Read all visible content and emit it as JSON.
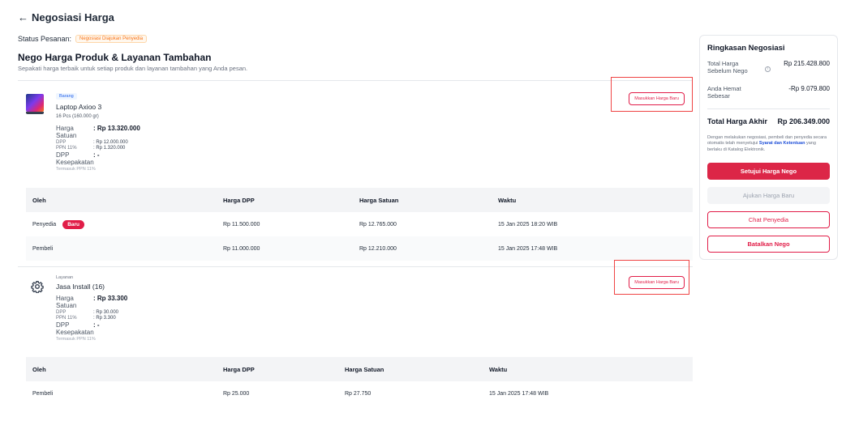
{
  "page": {
    "back_label": "Negosiasi Harga"
  },
  "order": {
    "status_label": "Status Pesanan:",
    "status_value": "Negosiasi Diajukan Penyedia"
  },
  "section": {
    "title": "Nego Harga Produk & Layanan Tambahan",
    "subtitle": "Sepakati harga terbaik untuk setiap produk dan layanan tambahan yang Anda pesan."
  },
  "items": [
    {
      "type_label": "Barang",
      "name": "Laptop Axioo 3",
      "qty": "16 Pcs (160.000 gr)",
      "harga_satuan_label": "Harga Satuan",
      "harga_satuan_value": ": Rp 13.320.000",
      "dpp_label": "DPP",
      "dpp_value": ": Rp 12.000.000",
      "ppn_label": "PPN 11%",
      "ppn_value": ": Rp 1.320.000",
      "dpp_kesepakatan_label": "DPP Kesepakatan",
      "dpp_kesepakatan_value": ": -",
      "note": "Termasuk PPN 11%",
      "action_label": "Masukkan Harga Baru",
      "table": {
        "headers": [
          "Oleh",
          "Harga DPP",
          "Harga Satuan",
          "Waktu"
        ],
        "rows": [
          {
            "oleh": "Penyedia",
            "badge": "Baru",
            "dpp": "Rp 11.500.000",
            "satuan": "Rp 12.765.000",
            "waktu": "15 Jan 2025 18:20 WIB"
          },
          {
            "oleh": "Pembeli",
            "badge": "",
            "dpp": "Rp 11.000.000",
            "satuan": "Rp 12.210.000",
            "waktu": "15 Jan 2025 17:48 WIB"
          }
        ]
      }
    },
    {
      "type_label": "Layanan",
      "name": "Jasa Install (16)",
      "harga_satuan_label": "Harga Satuan",
      "harga_satuan_value": ": Rp 33.300",
      "dpp_label": "DPP",
      "dpp_value": ": Rp 30.000",
      "ppn_label": "PPN 11%",
      "ppn_value": ": Rp 3.300",
      "dpp_kesepakatan_label": "DPP Kesepakatan",
      "dpp_kesepakatan_value": ": -",
      "note": "Termasuk PPN 11%",
      "action_label": "Masukkan Harga Baru",
      "table": {
        "headers": [
          "Oleh",
          "Harga DPP",
          "Harga Satuan",
          "Waktu"
        ],
        "rows": [
          {
            "oleh": "Pembeli",
            "dpp": "Rp 25.000",
            "satuan": "Rp 27.750",
            "waktu": "15 Jan 2025 17:48 WIB"
          }
        ]
      }
    }
  ],
  "summary": {
    "title": "Ringkasan Negosiasi",
    "before_label": "Total Harga Sebelum Nego",
    "before_value": "Rp 215.428.800",
    "saving_label": "Anda Hemat Sebesar",
    "saving_value": "-Rp 9.079.800",
    "total_label": "Total Harga Akhir",
    "total_value": "Rp 206.349.000",
    "disclaimer_prefix": "Dengan melakukan negosiasi, pembeli dan penyedia secara otomatis telah menyetujui ",
    "disclaimer_link": "Syarat dan Ketentuan",
    "disclaimer_suffix": " yang berlaku di Katalog Elektronik.",
    "approve_label": "Setujui Harga Nego",
    "propose_label": "Ajukan Harga Baru",
    "chat_label": "Chat Penyedia",
    "cancel_label": "Batalkan Nego"
  },
  "colors": {
    "accent": "#dc2647",
    "link": "#1d4ed8",
    "badge_orange": "#f97316",
    "annotation": "#ef4444"
  }
}
